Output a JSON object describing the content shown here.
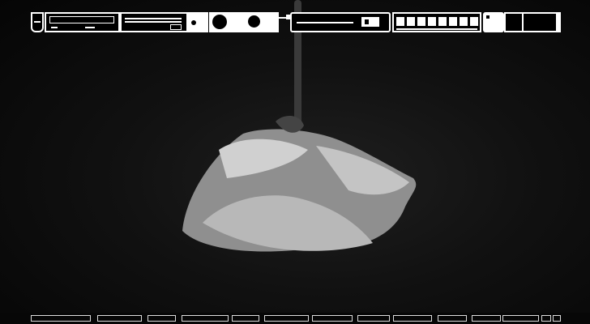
{
  "desktop": {
    "wallpaper_subject": "rose-wallpaper",
    "colors": {
      "panel_fg": "#ffffff",
      "panel_bg": "#000000",
      "wallpaper": "#111111"
    }
  },
  "topbar": {
    "widgets": [
      {
        "name": "logo-widget",
        "icon": "logo-icon"
      },
      {
        "name": "cd-player-widget",
        "icon": "cd-player-icon"
      },
      {
        "name": "cassette-deck-widget",
        "icon": "tape-deck-icon"
      },
      {
        "name": "system-monitor-widget",
        "icon": "gauge-icon"
      },
      {
        "name": "cooling-fan-widget",
        "icon": "fan-icon"
      },
      {
        "name": "volume-knob-widget",
        "icon": "knob-icon"
      },
      {
        "name": "connector-widget",
        "icon": "plug-icon"
      },
      {
        "name": "battery-widget",
        "icon": "battery-icon"
      },
      {
        "name": "workspace-switcher",
        "workspaces": 8
      },
      {
        "name": "tray-widget",
        "icon": "tray-icon"
      }
    ]
  },
  "dock": {
    "items": 14
  }
}
